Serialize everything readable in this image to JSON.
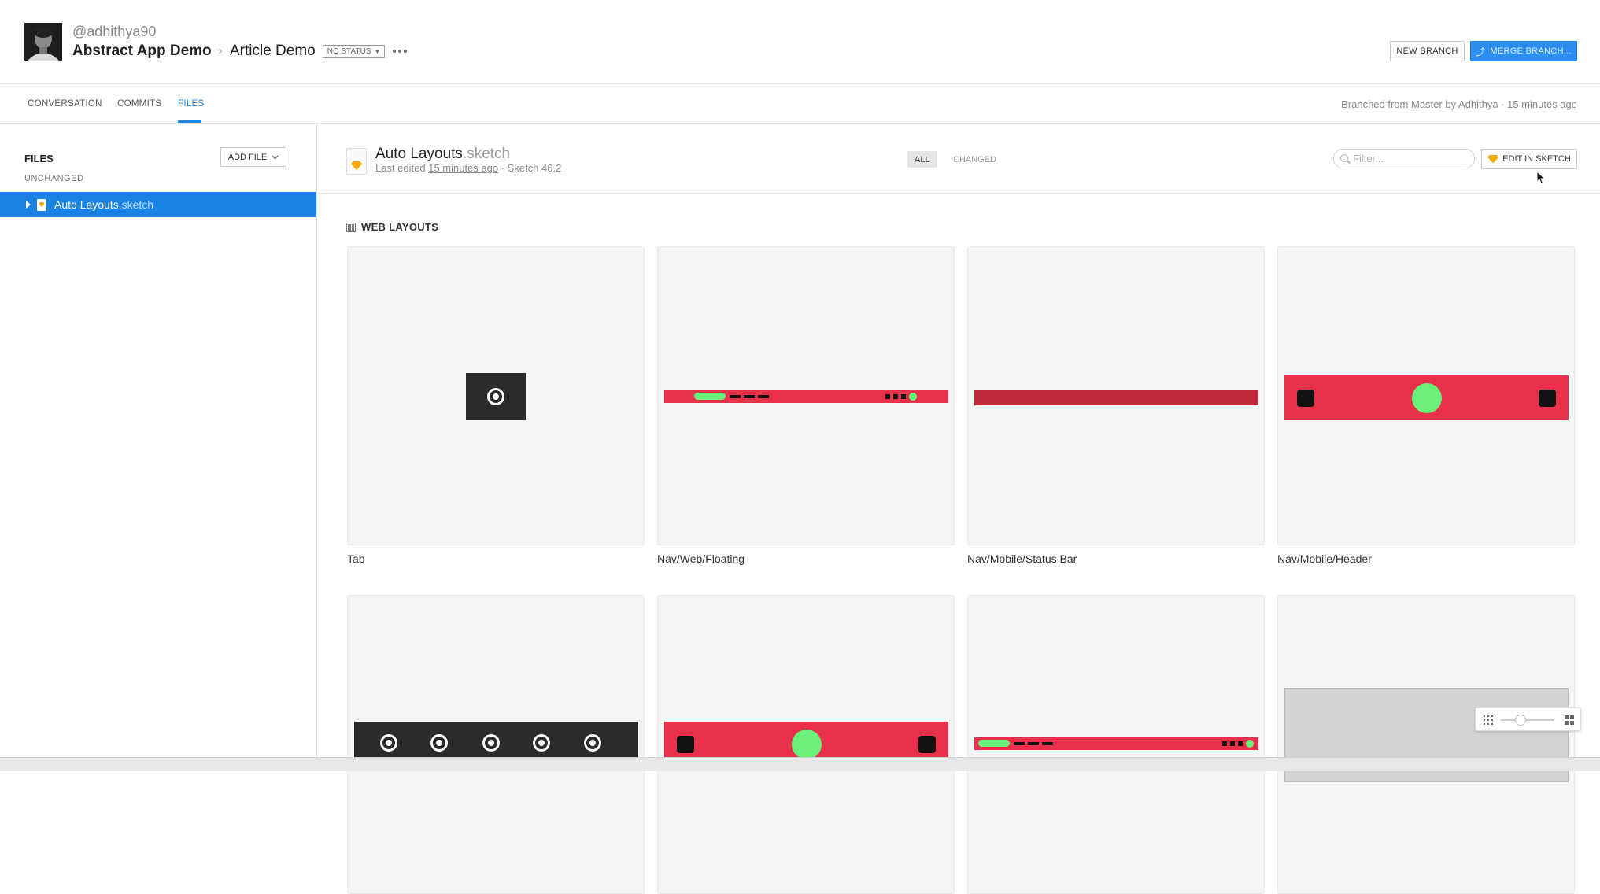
{
  "header": {
    "username": "@adhithya90",
    "project": "Abstract App Demo",
    "separator": "›",
    "branch": "Article Demo",
    "status": "NO STATUS",
    "new_branch_label": "NEW BRANCH",
    "merge_branch_label": "MERGE BRANCH..."
  },
  "tabs": [
    {
      "label": "CONVERSATION"
    },
    {
      "label": "COMMITS"
    },
    {
      "label": "FILES",
      "active": true
    }
  ],
  "branched_info": {
    "prefix": "Branched from ",
    "branch": "Master",
    "suffix": " by Adhithya · 15 minutes ago"
  },
  "sidebar": {
    "title": "FILES",
    "add_file_label": "ADD FILE",
    "group_label": "UNCHANGED",
    "file": {
      "name": "Auto Layouts",
      "ext": ".sketch"
    }
  },
  "file_header": {
    "name": "Auto Layouts",
    "ext": ".sketch",
    "meta_prefix": "Last edited ",
    "meta_time": "15 minutes ago",
    "meta_suffix": " · Sketch 46.2",
    "filter_all": "ALL",
    "filter_changed": "CHANGED",
    "filter_placeholder": "Filter...",
    "edit_label": "EDIT IN SKETCH"
  },
  "section": {
    "title": "WEB LAYOUTS"
  },
  "artboards": [
    {
      "name": "Tab"
    },
    {
      "name": "Nav/Web/Floating"
    },
    {
      "name": "Nav/Mobile/Status Bar"
    },
    {
      "name": "Nav/Mobile/Header"
    }
  ],
  "colors": {
    "accent": "#1a82e2",
    "brand_red": "#e8304a",
    "dark_red": "#c0283e",
    "green": "#6bf07a",
    "dark": "#2b2b2b"
  }
}
